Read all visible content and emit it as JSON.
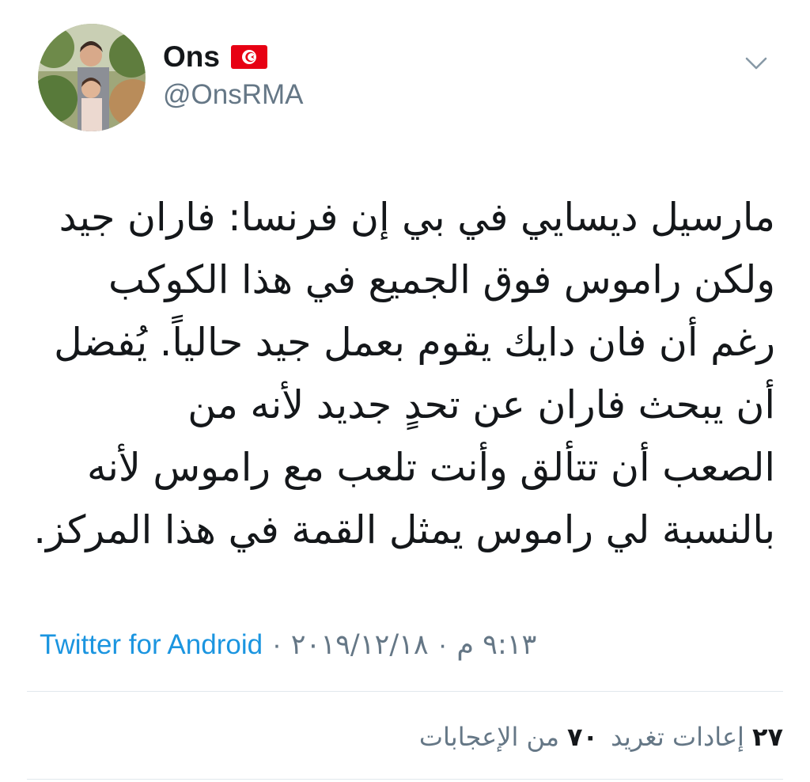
{
  "user": {
    "display_name": "Ons",
    "handle": "@OnsRMA",
    "flag_icon": "tunisia-flag-icon",
    "flag_color": "#e70013"
  },
  "tweet": {
    "lines": [
      "مارسيل ديسايي في بي إن فرنسا: فاران جيد",
      "ولكن راموس فوق الجميع في هذا الكوكب",
      "رغم أن فان دايك يقوم بعمل جيد حالياً. يُفضل",
      "أن يبحث فاران عن تحدٍ جديد لأنه من",
      "الصعب أن تتألق وأنت تلعب مع راموس لأنه",
      "بالنسبة لي راموس يمثل القمة في هذا المركز."
    ],
    "source": "Twitter for Android",
    "date": "٢٠١٩/١٢/١٨",
    "time": "٩:١٣ م",
    "separator": "·"
  },
  "stats": {
    "likes_count": "٧٠",
    "likes_label": "من الإعجابات",
    "retweets_count": "٢٧",
    "retweets_label": "إعادات تغريد"
  },
  "colors": {
    "link": "#1b95e0",
    "secondary_text": "#657786",
    "divider": "#e1e8ed"
  }
}
